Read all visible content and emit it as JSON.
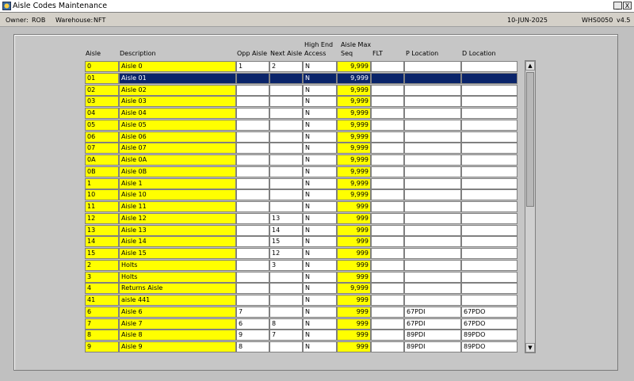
{
  "window": {
    "title": "Aisle Codes Maintenance",
    "minimize": "_",
    "close": "X"
  },
  "info": {
    "owner_label": "Owner:",
    "owner": "ROB",
    "warehouse_label": "Warehouse:",
    "warehouse": "NFT",
    "date": "10-JUN-2025",
    "program": "WHS0050",
    "version": "v4.5"
  },
  "columns": {
    "aisle": "Aisle",
    "description": "Description",
    "opp_aisle": "Opp Aisle",
    "next_aisle": "Next Aisle",
    "high_end_1": "High End",
    "high_end_2": "Access",
    "max_seq_1": "Aisle Max",
    "max_seq_2": "Seq",
    "flt": "FLT",
    "p_location": "P Location",
    "d_location": "D Location"
  },
  "rows": [
    {
      "aisle": "0",
      "desc": "Aisle 0",
      "opp": "1",
      "next": "2",
      "high": "N",
      "seq": "9,999",
      "flt": "",
      "p": "",
      "d": ""
    },
    {
      "aisle": "01",
      "desc": "Aisle 01",
      "opp": "",
      "next": "",
      "high": "N",
      "seq": "9,999",
      "flt": "",
      "p": "",
      "d": ""
    },
    {
      "aisle": "02",
      "desc": "Aisle 02",
      "opp": "",
      "next": "",
      "high": "N",
      "seq": "9,999",
      "flt": "",
      "p": "",
      "d": ""
    },
    {
      "aisle": "03",
      "desc": "Aisle 03",
      "opp": "",
      "next": "",
      "high": "N",
      "seq": "9,999",
      "flt": "",
      "p": "",
      "d": ""
    },
    {
      "aisle": "04",
      "desc": "Aisle 04",
      "opp": "",
      "next": "",
      "high": "N",
      "seq": "9,999",
      "flt": "",
      "p": "",
      "d": ""
    },
    {
      "aisle": "05",
      "desc": "Aisle 05",
      "opp": "",
      "next": "",
      "high": "N",
      "seq": "9,999",
      "flt": "",
      "p": "",
      "d": ""
    },
    {
      "aisle": "06",
      "desc": "Aisle 06",
      "opp": "",
      "next": "",
      "high": "N",
      "seq": "9,999",
      "flt": "",
      "p": "",
      "d": ""
    },
    {
      "aisle": "07",
      "desc": "Aisle 07",
      "opp": "",
      "next": "",
      "high": "N",
      "seq": "9,999",
      "flt": "",
      "p": "",
      "d": ""
    },
    {
      "aisle": "0A",
      "desc": "Aisle 0A",
      "opp": "",
      "next": "",
      "high": "N",
      "seq": "9,999",
      "flt": "",
      "p": "",
      "d": ""
    },
    {
      "aisle": "0B",
      "desc": "Aisle 0B",
      "opp": "",
      "next": "",
      "high": "N",
      "seq": "9,999",
      "flt": "",
      "p": "",
      "d": ""
    },
    {
      "aisle": "1",
      "desc": "Aisle 1",
      "opp": "",
      "next": "",
      "high": "N",
      "seq": "9,999",
      "flt": "",
      "p": "",
      "d": ""
    },
    {
      "aisle": "10",
      "desc": "Aisle 10",
      "opp": "",
      "next": "",
      "high": "N",
      "seq": "9,999",
      "flt": "",
      "p": "",
      "d": ""
    },
    {
      "aisle": "11",
      "desc": "Aisle 11",
      "opp": "",
      "next": "",
      "high": "N",
      "seq": "999",
      "flt": "",
      "p": "",
      "d": ""
    },
    {
      "aisle": "12",
      "desc": "Aisle 12",
      "opp": "",
      "next": "13",
      "high": "N",
      "seq": "999",
      "flt": "",
      "p": "",
      "d": ""
    },
    {
      "aisle": "13",
      "desc": "Aisle 13",
      "opp": "",
      "next": "14",
      "high": "N",
      "seq": "999",
      "flt": "",
      "p": "",
      "d": ""
    },
    {
      "aisle": "14",
      "desc": "Aisle 14",
      "opp": "",
      "next": "15",
      "high": "N",
      "seq": "999",
      "flt": "",
      "p": "",
      "d": ""
    },
    {
      "aisle": "15",
      "desc": "Aisle 15",
      "opp": "",
      "next": "12",
      "high": "N",
      "seq": "999",
      "flt": "",
      "p": "",
      "d": ""
    },
    {
      "aisle": "2",
      "desc": "Holts",
      "opp": "",
      "next": "3",
      "high": "N",
      "seq": "999",
      "flt": "",
      "p": "",
      "d": ""
    },
    {
      "aisle": "3",
      "desc": "Holts",
      "opp": "",
      "next": "",
      "high": "N",
      "seq": "999",
      "flt": "",
      "p": "",
      "d": ""
    },
    {
      "aisle": "4",
      "desc": "Returns Aisle",
      "opp": "",
      "next": "",
      "high": "N",
      "seq": "9,999",
      "flt": "",
      "p": "",
      "d": ""
    },
    {
      "aisle": "41",
      "desc": "aisle 441",
      "opp": "",
      "next": "",
      "high": "N",
      "seq": "999",
      "flt": "",
      "p": "",
      "d": ""
    },
    {
      "aisle": "6",
      "desc": "Aisle 6",
      "opp": "7",
      "next": "",
      "high": "N",
      "seq": "999",
      "flt": "",
      "p": "67PDI",
      "d": "67PDO"
    },
    {
      "aisle": "7",
      "desc": "Aisle 7",
      "opp": "6",
      "next": "8",
      "high": "N",
      "seq": "999",
      "flt": "",
      "p": "67PDI",
      "d": "67PDO"
    },
    {
      "aisle": "8",
      "desc": "Aisle 8",
      "opp": "9",
      "next": "7",
      "high": "N",
      "seq": "999",
      "flt": "",
      "p": "89PDI",
      "d": "89PDO"
    },
    {
      "aisle": "9",
      "desc": "Aisle 9",
      "opp": "8",
      "next": "",
      "high": "N",
      "seq": "999",
      "flt": "",
      "p": "89PDI",
      "d": "89PDO"
    }
  ],
  "selected_row": 1,
  "scrollbar": {
    "up": "▲",
    "down": "▼"
  },
  "colors": {
    "required_field": "#ffff00",
    "selection": "#0a246a",
    "background": "#c0c0c0"
  }
}
